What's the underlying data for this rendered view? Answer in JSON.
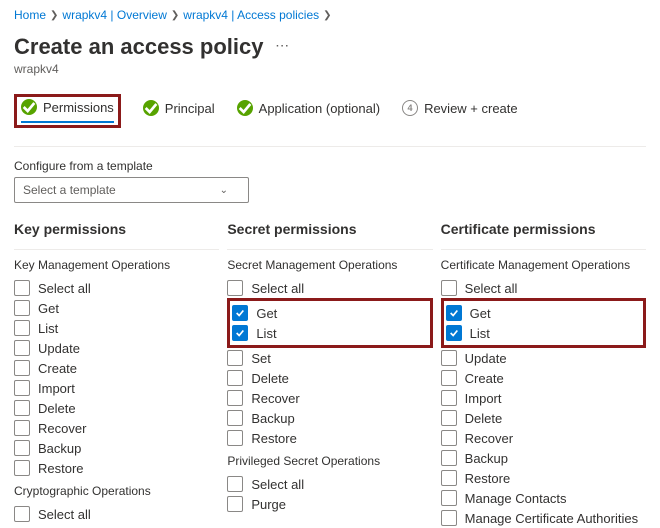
{
  "breadcrumb": {
    "items": [
      {
        "label": "Home"
      },
      {
        "label": "wrapkv4 | Overview"
      },
      {
        "label": "wrapkv4 | Access policies"
      }
    ]
  },
  "header": {
    "title": "Create an access policy",
    "subtitle": "wrapkv4"
  },
  "steps": [
    {
      "label": "Permissions",
      "state": "done",
      "active": true,
      "highlighted": true
    },
    {
      "label": "Principal",
      "state": "done"
    },
    {
      "label": "Application (optional)",
      "state": "done"
    },
    {
      "label": "Review + create",
      "state": "pending",
      "num": "4"
    }
  ],
  "template": {
    "label": "Configure from a template",
    "placeholder": "Select a template"
  },
  "columns": [
    {
      "title": "Key permissions",
      "groups": [
        {
          "title": "Key Management Operations",
          "items": [
            {
              "label": "Select all"
            },
            {
              "label": "Get"
            },
            {
              "label": "List"
            },
            {
              "label": "Update"
            },
            {
              "label": "Create"
            },
            {
              "label": "Import"
            },
            {
              "label": "Delete"
            },
            {
              "label": "Recover"
            },
            {
              "label": "Backup"
            },
            {
              "label": "Restore"
            }
          ]
        },
        {
          "title": "Cryptographic Operations",
          "items": [
            {
              "label": "Select all"
            }
          ]
        }
      ]
    },
    {
      "title": "Secret permissions",
      "groups": [
        {
          "title": "Secret Management Operations",
          "items": [
            {
              "label": "Select all"
            },
            {
              "label": "Get",
              "checked": true,
              "hlStart": true
            },
            {
              "label": "List",
              "checked": true,
              "hlEnd": true
            },
            {
              "label": "Set"
            },
            {
              "label": "Delete"
            },
            {
              "label": "Recover"
            },
            {
              "label": "Backup"
            },
            {
              "label": "Restore"
            }
          ]
        },
        {
          "title": "Privileged Secret Operations",
          "items": [
            {
              "label": "Select all"
            },
            {
              "label": "Purge"
            }
          ]
        }
      ]
    },
    {
      "title": "Certificate permissions",
      "groups": [
        {
          "title": "Certificate Management Operations",
          "items": [
            {
              "label": "Select all"
            },
            {
              "label": "Get",
              "checked": true,
              "hlStart": true
            },
            {
              "label": "List",
              "checked": true,
              "hlEnd": true
            },
            {
              "label": "Update"
            },
            {
              "label": "Create"
            },
            {
              "label": "Import"
            },
            {
              "label": "Delete"
            },
            {
              "label": "Recover"
            },
            {
              "label": "Backup"
            },
            {
              "label": "Restore"
            },
            {
              "label": "Manage Contacts"
            },
            {
              "label": "Manage Certificate Authorities"
            }
          ]
        }
      ]
    }
  ]
}
